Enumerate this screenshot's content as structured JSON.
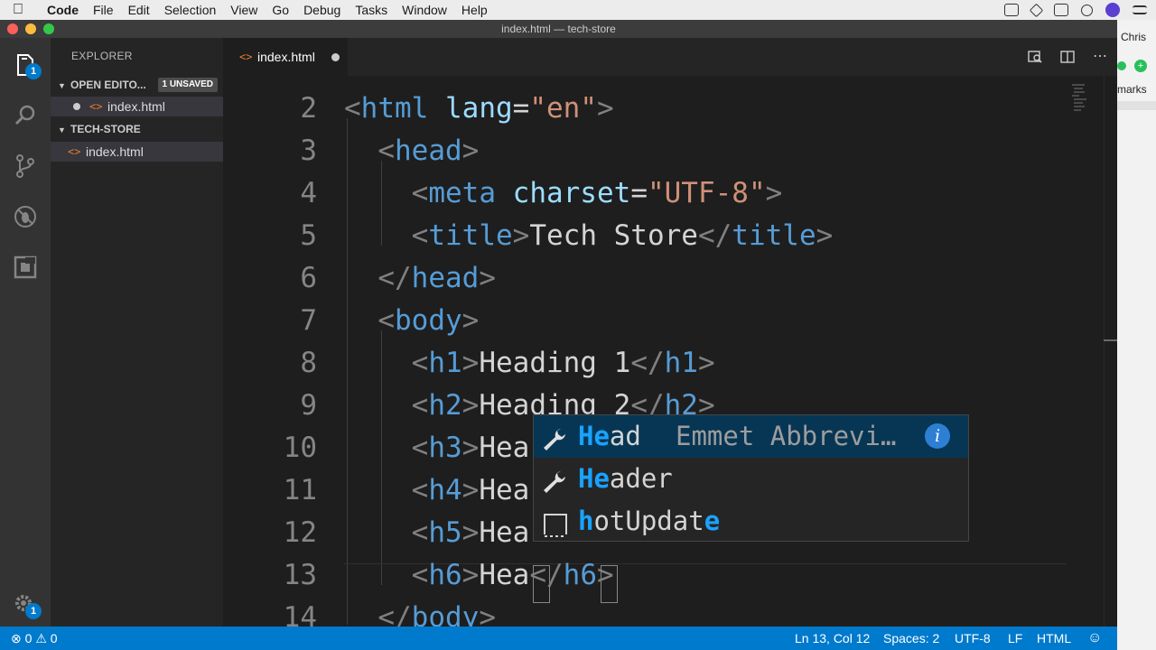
{
  "menubar": {
    "app": "Code",
    "items": [
      "File",
      "Edit",
      "Selection",
      "View",
      "Go",
      "Debug",
      "Tasks",
      "Window",
      "Help"
    ]
  },
  "window": {
    "title": "index.html — tech-store"
  },
  "desktop": {
    "user": "Chris",
    "partial_text": "marks",
    "plus": "+"
  },
  "activity": {
    "explorer_badge": "1",
    "settings_badge": "1"
  },
  "sidebar": {
    "title": "EXPLORER",
    "open_editors": {
      "label": "OPEN EDITO...",
      "badge": "1 UNSAVED",
      "file": "index.html"
    },
    "project": {
      "label": "TECH-STORE",
      "file": "index.html"
    }
  },
  "tab": {
    "label": "index.html",
    "file_icon": "<>"
  },
  "editor": {
    "line_numbers": [
      "2",
      "3",
      "4",
      "5",
      "6",
      "7",
      "8",
      "9",
      "10",
      "11",
      "12",
      "13",
      "14"
    ],
    "lines": [
      [
        {
          "c": "t-br",
          "t": "<"
        },
        {
          "c": "t-tag",
          "t": "html"
        },
        {
          "c": "t-tx",
          "t": " "
        },
        {
          "c": "t-at",
          "t": "lang"
        },
        {
          "c": "t-tx",
          "t": "="
        },
        {
          "c": "t-str",
          "t": "\"en\""
        },
        {
          "c": "t-br",
          "t": ">"
        }
      ],
      [
        {
          "c": "t-tx",
          "t": "  "
        },
        {
          "c": "t-br",
          "t": "<"
        },
        {
          "c": "t-tag",
          "t": "head"
        },
        {
          "c": "t-br",
          "t": ">"
        }
      ],
      [
        {
          "c": "t-tx",
          "t": "    "
        },
        {
          "c": "t-br",
          "t": "<"
        },
        {
          "c": "t-tag",
          "t": "meta"
        },
        {
          "c": "t-tx",
          "t": " "
        },
        {
          "c": "t-at",
          "t": "charset"
        },
        {
          "c": "t-tx",
          "t": "="
        },
        {
          "c": "t-str",
          "t": "\"UTF-8\""
        },
        {
          "c": "t-br",
          "t": ">"
        }
      ],
      [
        {
          "c": "t-tx",
          "t": "    "
        },
        {
          "c": "t-br",
          "t": "<"
        },
        {
          "c": "t-tag",
          "t": "title"
        },
        {
          "c": "t-br",
          "t": ">"
        },
        {
          "c": "t-tx",
          "t": "Tech Store"
        },
        {
          "c": "t-br",
          "t": "</"
        },
        {
          "c": "t-tag",
          "t": "title"
        },
        {
          "c": "t-br",
          "t": ">"
        }
      ],
      [
        {
          "c": "t-tx",
          "t": "  "
        },
        {
          "c": "t-br",
          "t": "</"
        },
        {
          "c": "t-tag",
          "t": "head"
        },
        {
          "c": "t-br",
          "t": ">"
        }
      ],
      [
        {
          "c": "t-tx",
          "t": "  "
        },
        {
          "c": "t-br",
          "t": "<"
        },
        {
          "c": "t-tag",
          "t": "body"
        },
        {
          "c": "t-br",
          "t": ">"
        }
      ],
      [
        {
          "c": "t-tx",
          "t": "    "
        },
        {
          "c": "t-br",
          "t": "<"
        },
        {
          "c": "t-tag",
          "t": "h1"
        },
        {
          "c": "t-br",
          "t": ">"
        },
        {
          "c": "t-tx",
          "t": "Heading 1"
        },
        {
          "c": "t-br",
          "t": "</"
        },
        {
          "c": "t-tag",
          "t": "h1"
        },
        {
          "c": "t-br",
          "t": ">"
        }
      ],
      [
        {
          "c": "t-tx",
          "t": "    "
        },
        {
          "c": "t-br",
          "t": "<"
        },
        {
          "c": "t-tag",
          "t": "h2"
        },
        {
          "c": "t-br",
          "t": ">"
        },
        {
          "c": "t-tx",
          "t": "Heading 2"
        },
        {
          "c": "t-br",
          "t": "</"
        },
        {
          "c": "t-tag",
          "t": "h2"
        },
        {
          "c": "t-br",
          "t": ">"
        }
      ],
      [
        {
          "c": "t-tx",
          "t": "    "
        },
        {
          "c": "t-br",
          "t": "<"
        },
        {
          "c": "t-tag",
          "t": "h3"
        },
        {
          "c": "t-br",
          "t": ">"
        },
        {
          "c": "t-tx",
          "t": "Hea"
        }
      ],
      [
        {
          "c": "t-tx",
          "t": "    "
        },
        {
          "c": "t-br",
          "t": "<"
        },
        {
          "c": "t-tag",
          "t": "h4"
        },
        {
          "c": "t-br",
          "t": ">"
        },
        {
          "c": "t-tx",
          "t": "Hea"
        }
      ],
      [
        {
          "c": "t-tx",
          "t": "    "
        },
        {
          "c": "t-br",
          "t": "<"
        },
        {
          "c": "t-tag",
          "t": "h5"
        },
        {
          "c": "t-br",
          "t": ">"
        },
        {
          "c": "t-tx",
          "t": "Hea"
        }
      ],
      [
        {
          "c": "t-tx",
          "t": "    "
        },
        {
          "c": "t-br",
          "t": "<"
        },
        {
          "c": "t-tag",
          "t": "h6"
        },
        {
          "c": "t-br",
          "t": ">"
        },
        {
          "c": "t-tx",
          "t": "Hea"
        },
        {
          "c": "t-br",
          "t": "</"
        },
        {
          "c": "t-tag",
          "t": "h6"
        },
        {
          "c": "t-br",
          "t": ">"
        }
      ],
      [
        {
          "c": "t-tx",
          "t": "  "
        },
        {
          "c": "t-br",
          "t": "</"
        },
        {
          "c": "t-tag",
          "t": "body"
        },
        {
          "c": "t-br",
          "t": ">"
        }
      ]
    ]
  },
  "suggest": {
    "items": [
      {
        "match": "He",
        "rest": "ad",
        "detail": "Emmet Abbrevi…",
        "icon": "wrench-icon",
        "selected": true
      },
      {
        "match": "He",
        "rest": "ader",
        "detail": "",
        "icon": "wrench-icon",
        "selected": false
      },
      {
        "match": "h",
        "rest": "otUpdat",
        "tail_match": "e",
        "detail": "",
        "icon": "snippet-icon",
        "selected": false
      }
    ],
    "info_label": "i"
  },
  "status": {
    "errors": "0",
    "warnings": "0",
    "position": "Ln 13, Col 12",
    "spaces": "Spaces: 2",
    "encoding": "UTF-8",
    "eol": "LF",
    "language": "HTML"
  },
  "colors": {
    "accent": "#007acc",
    "match_highlight": "#18a3ff",
    "selected_suggestion": "#073655"
  }
}
